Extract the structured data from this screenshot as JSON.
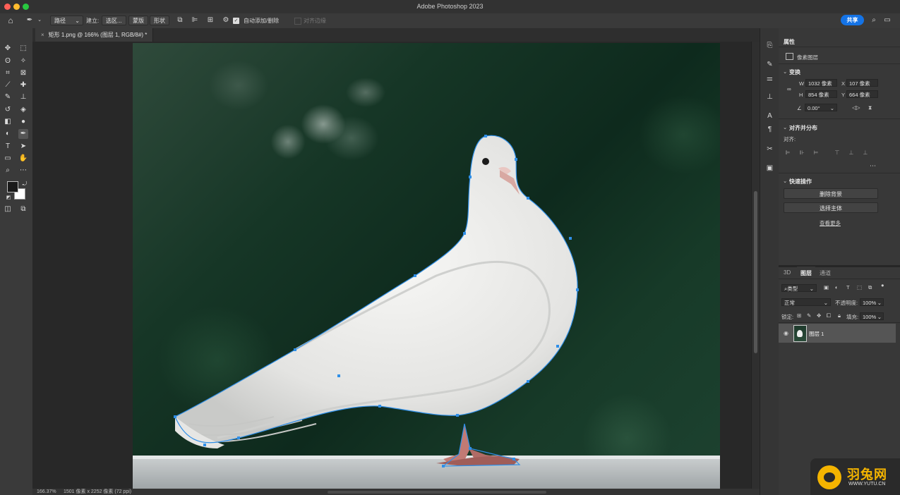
{
  "window": {
    "title": "Adobe Photoshop 2023"
  },
  "options_bar": {
    "mode_select": "路径",
    "build_label": "建立:",
    "selection_btn": "选区...",
    "mask_btn": "蒙版",
    "shape_btn": "形状",
    "auto_add_delete": "自动添加/删除",
    "align_edges": "对齐边缘",
    "share": "共享"
  },
  "document": {
    "tab_title": "矩形 1.png @ 166% (图层 1, RGB/8#) *"
  },
  "status": {
    "zoom": "166.37%",
    "doc_info": "1501 像素 x 2252 像素 (72 ppi)"
  },
  "properties": {
    "tab": "属性",
    "type": "像素图层",
    "transform_header": "变换",
    "w_label": "W",
    "w_value": "1032 像素",
    "x_label": "X",
    "x_value": "107 像素",
    "h_label": "H",
    "h_value": "854 像素",
    "y_label": "Y",
    "y_value": "664 像素",
    "angle_value": "0.00°",
    "align_header": "对齐并分布",
    "align_label": "对齐:",
    "quick_header": "快速操作",
    "remove_bg": "删除背景",
    "select_subject": "选择主体",
    "see_more": "查看更多"
  },
  "layers_panel": {
    "tabs": [
      "3D",
      "图层",
      "通道"
    ],
    "filter_kind": "类型",
    "blend_mode": "正常",
    "opacity_label": "不透明度:",
    "opacity_value": "100%",
    "lock_label": "锁定:",
    "fill_label": "填充:",
    "fill_value": "100%",
    "layers": [
      {
        "name": "图层 1",
        "visible": true
      }
    ]
  },
  "watermark": {
    "text": "羽兔网",
    "url": "WWW.YUTU.CN"
  },
  "colors": {
    "accent": "#1473e6",
    "path": "#2f8fe8",
    "foreground": "#1a1a1a",
    "background": "#ffffff"
  }
}
